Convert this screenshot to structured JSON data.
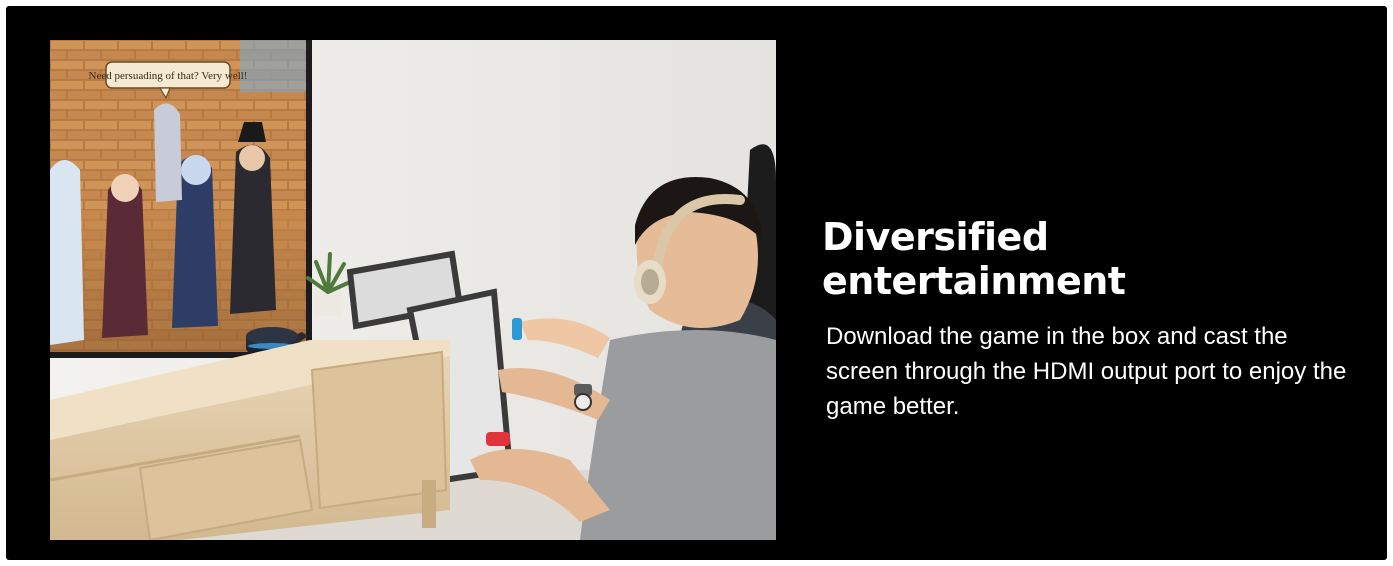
{
  "banner": {
    "headline": "Diversified entertainment",
    "description": "Download the game in the box and cast the screen through the HDMI output port to enjoy the game better."
  },
  "photo": {
    "game_speech_bubble": "Need persuading of that? Very well!"
  }
}
